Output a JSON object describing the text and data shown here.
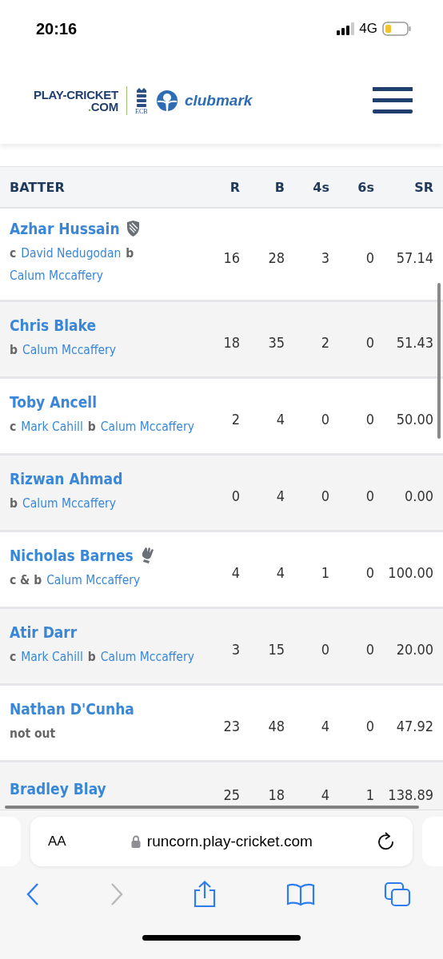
{
  "status_bar": {
    "time": "20:16",
    "network": "4G"
  },
  "header": {
    "logo_line1": "PLAY-CRICKET",
    "logo_dot": ".",
    "logo_line2": "COM",
    "ecb": "ECB",
    "clubmark": "clubmark"
  },
  "table": {
    "columns": [
      "BATTER",
      "R",
      "B",
      "4s",
      "6s",
      "SR"
    ],
    "rows": [
      {
        "name": "Azhar Hussain",
        "captain": true,
        "dismissal": [
          {
            "kind": "mode",
            "text": "c"
          },
          {
            "kind": "player",
            "text": "David Nedugodan"
          },
          {
            "kind": "mode",
            "text": "b"
          },
          {
            "kind": "player",
            "text": "Calum Mccaffery"
          }
        ],
        "stats": [
          "16",
          "28",
          "3",
          "0",
          "57.14"
        ]
      },
      {
        "name": "Chris Blake",
        "dismissal": [
          {
            "kind": "mode",
            "text": "b"
          },
          {
            "kind": "player",
            "text": "Calum Mccaffery"
          }
        ],
        "stats": [
          "18",
          "35",
          "2",
          "0",
          "51.43"
        ]
      },
      {
        "name": "Toby Ancell",
        "dismissal": [
          {
            "kind": "mode",
            "text": "c"
          },
          {
            "kind": "player",
            "text": "Mark Cahill"
          },
          {
            "kind": "mode",
            "text": "b"
          },
          {
            "kind": "player",
            "text": "Calum Mccaffery"
          }
        ],
        "stats": [
          "2",
          "4",
          "0",
          "0",
          "50.00"
        ]
      },
      {
        "name": "Rizwan Ahmad",
        "dismissal": [
          {
            "kind": "mode",
            "text": "b"
          },
          {
            "kind": "player",
            "text": "Calum Mccaffery"
          }
        ],
        "stats": [
          "0",
          "4",
          "0",
          "0",
          "0.00"
        ]
      },
      {
        "name": "Nicholas Barnes",
        "wicketkeeper": true,
        "dismissal": [
          {
            "kind": "mode",
            "text": "c & b"
          },
          {
            "kind": "player",
            "text": "Calum Mccaffery"
          }
        ],
        "stats": [
          "4",
          "4",
          "1",
          "0",
          "100.00"
        ]
      },
      {
        "name": "Atir Darr",
        "dismissal": [
          {
            "kind": "mode",
            "text": "c"
          },
          {
            "kind": "player",
            "text": "Mark Cahill"
          },
          {
            "kind": "mode",
            "text": "b"
          },
          {
            "kind": "player",
            "text": "Calum Mccaffery"
          }
        ],
        "stats": [
          "3",
          "15",
          "0",
          "0",
          "20.00"
        ]
      },
      {
        "name": "Nathan D'Cunha",
        "dismissal": [
          {
            "kind": "mode",
            "text": "not out"
          }
        ],
        "stats": [
          "23",
          "48",
          "4",
          "0",
          "47.92"
        ]
      },
      {
        "name": "Bradley Blay",
        "stats": [
          "25",
          "18",
          "4",
          "1",
          "138.89"
        ]
      }
    ]
  },
  "browser": {
    "text_size": "AA",
    "url": "runcorn.play-cricket.com"
  }
}
